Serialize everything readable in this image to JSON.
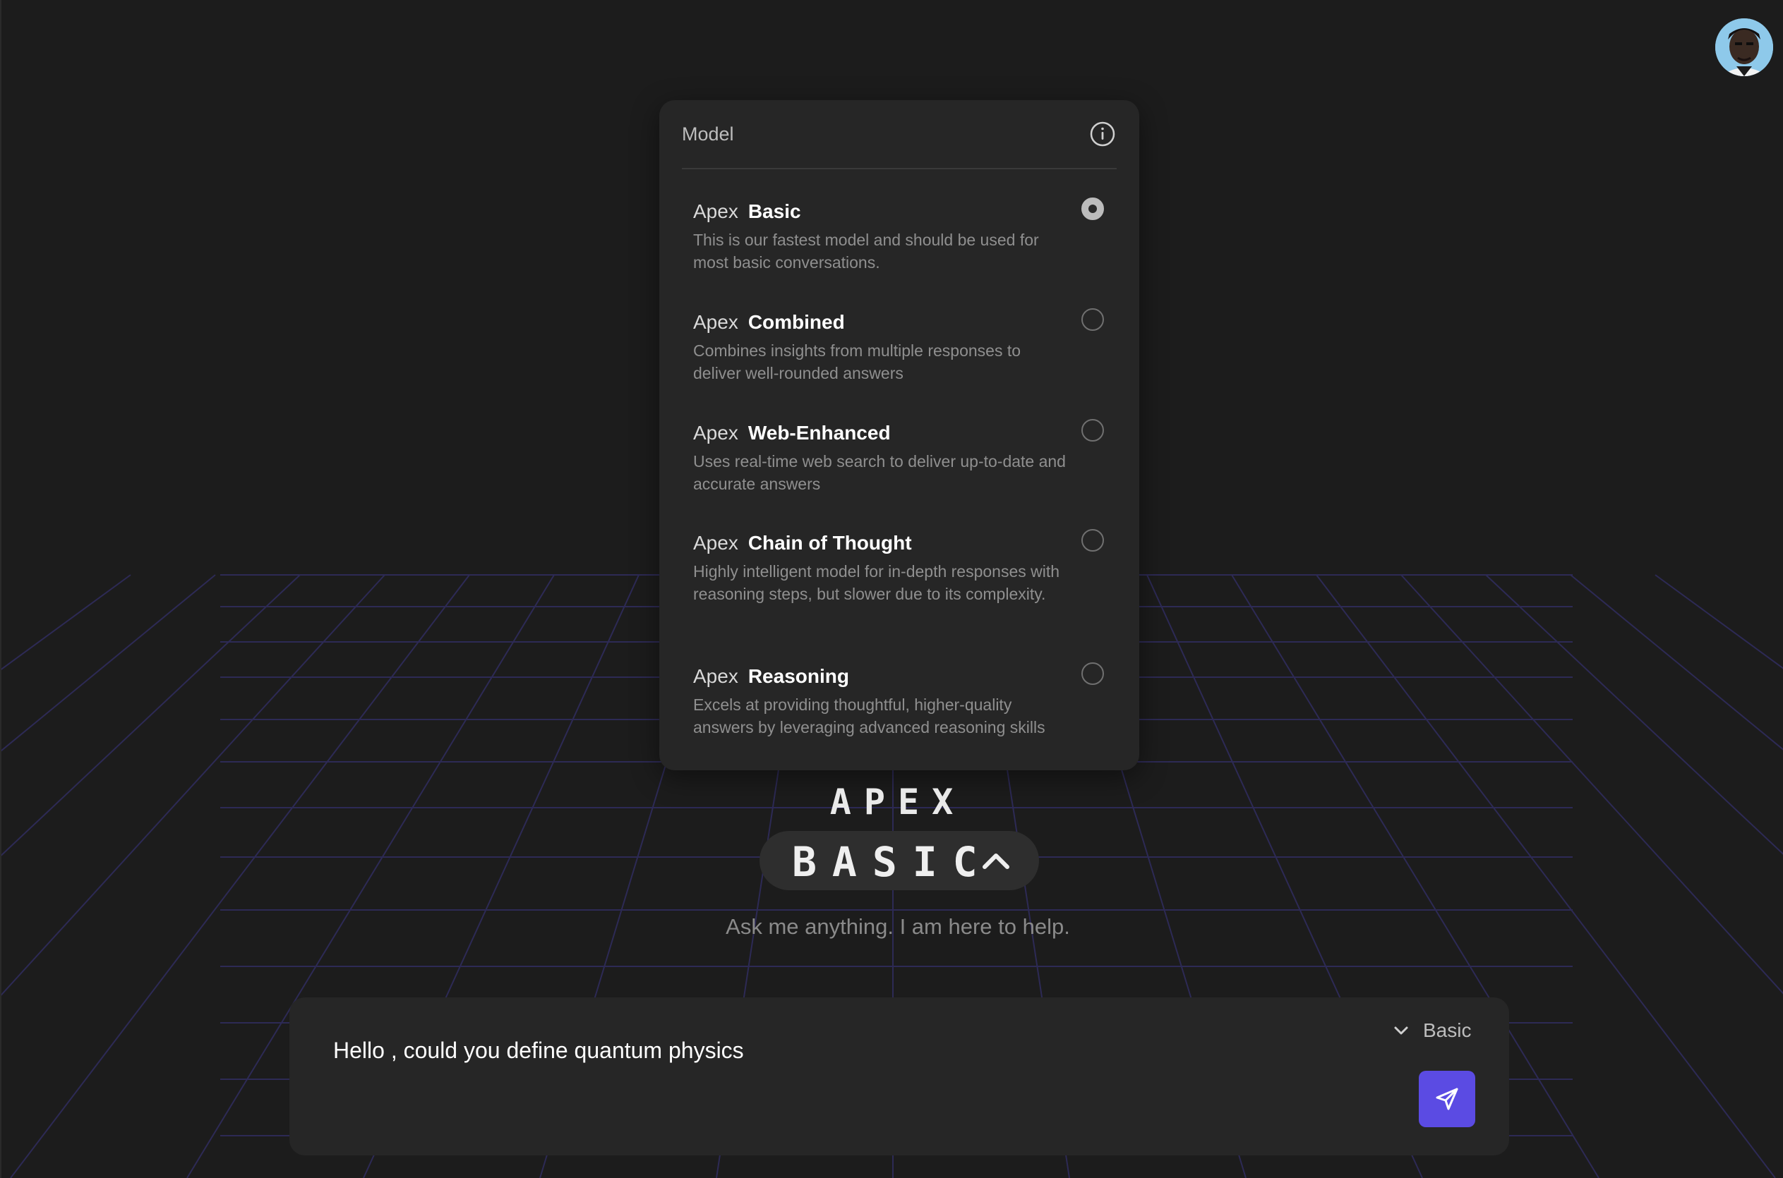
{
  "panel": {
    "title": "Model",
    "options": [
      {
        "brand": "Apex",
        "variant": "Basic",
        "description": "This is our fastest model and should be used for most basic conversations.",
        "selected": true
      },
      {
        "brand": "Apex",
        "variant": "Combined",
        "description": "Combines insights from multiple responses to deliver well-rounded answers",
        "selected": false
      },
      {
        "brand": "Apex",
        "variant": "Web-Enhanced",
        "description": "Uses real-time web search to deliver up-to-date and accurate answers",
        "selected": false
      },
      {
        "brand": "Apex",
        "variant": "Chain of Thought",
        "description": "Highly intelligent model for in-depth responses with reasoning steps, but slower due to its complexity.",
        "selected": false
      },
      {
        "brand": "Apex",
        "variant": "Reasoning",
        "description": "Excels at providing thoughtful, higher-quality answers by leveraging advanced reasoning skills",
        "selected": false
      }
    ]
  },
  "hero": {
    "brand": "APEX",
    "model": "BASIC",
    "tagline": "Ask me anything. I am here to help."
  },
  "composer": {
    "value": "Hello , could you define quantum physics",
    "model_label": "Basic"
  },
  "colors": {
    "background": "#1c1c1c",
    "panel": "#262626",
    "accent": "#5b4be3",
    "grid_line": "#2d2a55"
  },
  "icons": {
    "info": "info-icon",
    "chevron_up": "chevron-up-icon",
    "chevron_down": "chevron-down-icon",
    "send": "send-icon",
    "avatar": "user-avatar"
  }
}
